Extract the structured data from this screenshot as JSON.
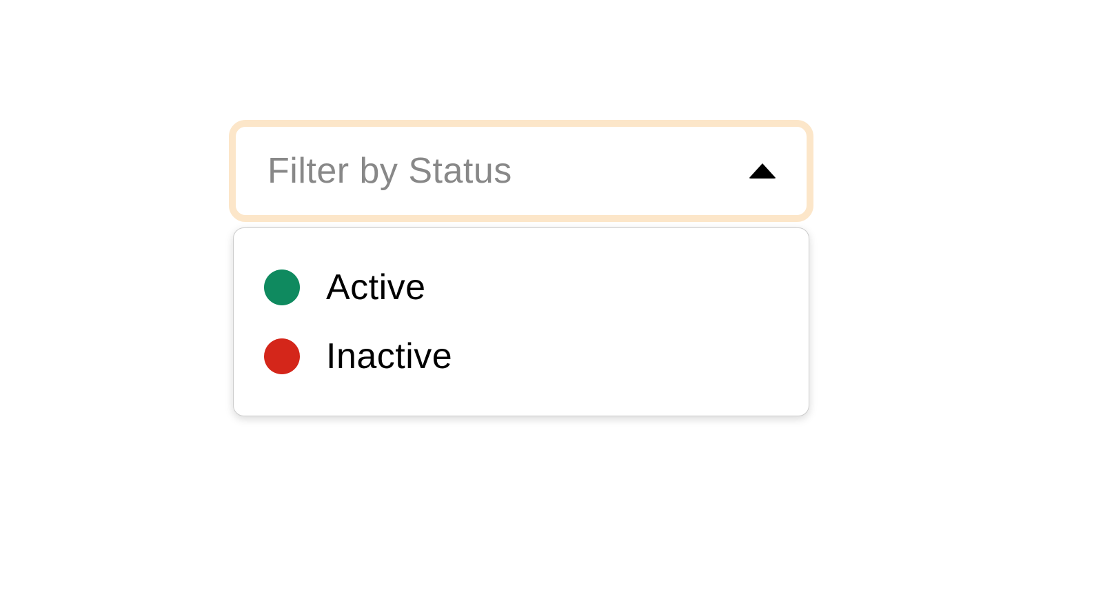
{
  "filter": {
    "placeholder": "Filter by Status",
    "options": [
      {
        "label": "Active",
        "color": "#0f8a5f"
      },
      {
        "label": "Inactive",
        "color": "#d4261a"
      }
    ]
  }
}
